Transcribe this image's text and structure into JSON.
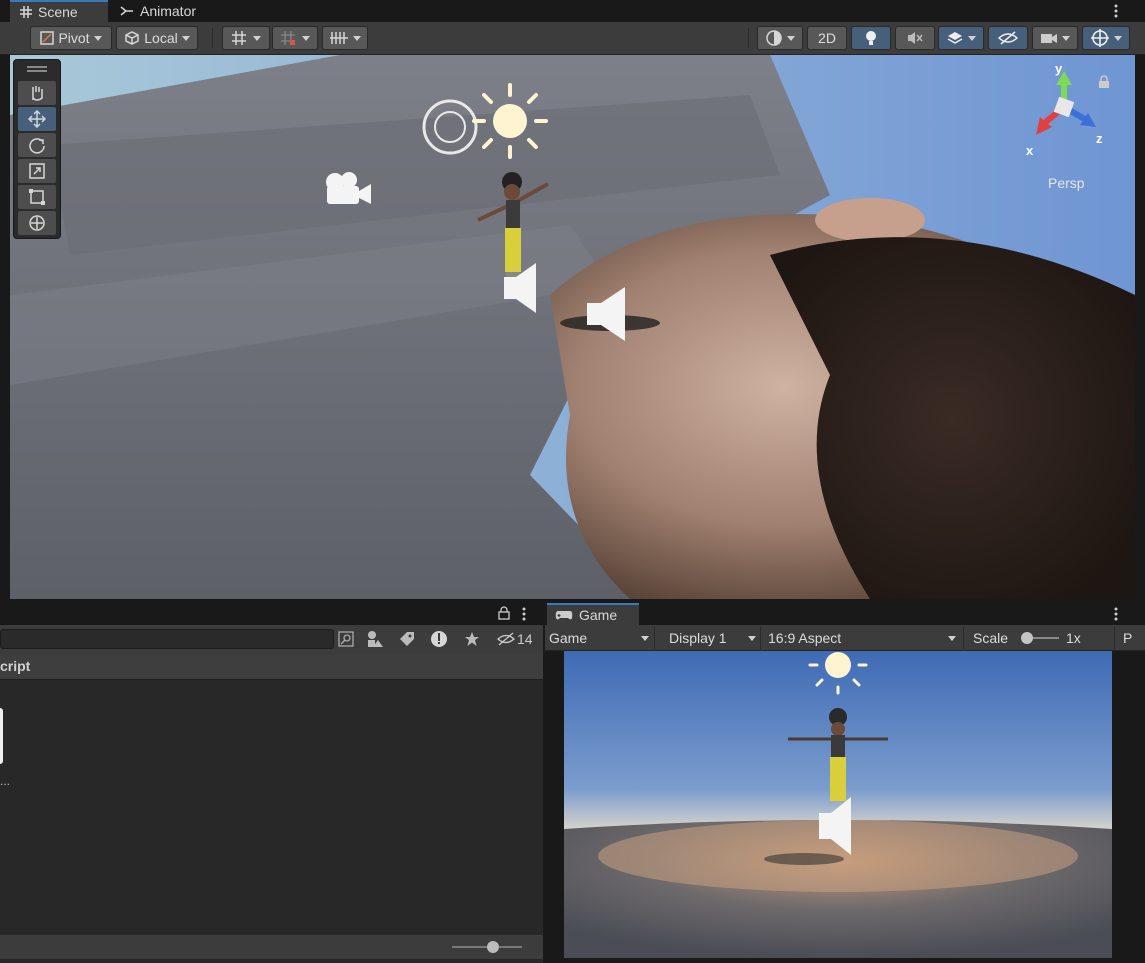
{
  "tabs": [
    {
      "label": "Scene",
      "icon": "grid-icon",
      "active": true
    },
    {
      "label": "Animator",
      "icon": "animator-icon",
      "active": false
    }
  ],
  "toolbar": {
    "pivot_label": "Pivot",
    "local_label": "Local",
    "mode_2d_label": "2D"
  },
  "scene": {
    "camera_mode_label": "Persp",
    "axes": {
      "x": "x",
      "y": "y",
      "z": "z"
    }
  },
  "left_panel": {
    "search_placeholder": "",
    "hidden_count": "14",
    "list_item_label": "cript",
    "truncated_text": "..."
  },
  "game": {
    "tab_label": "Game",
    "view_select": "Game",
    "display_select": "Display 1",
    "aspect_select": "16:9 Aspect",
    "scale_label": "Scale",
    "scale_value": "1x",
    "clipped_label": "P"
  },
  "colors": {
    "accent": "#3a79bb",
    "toolbar_bg": "#3c3c3c",
    "selected_button": "#46607c"
  }
}
